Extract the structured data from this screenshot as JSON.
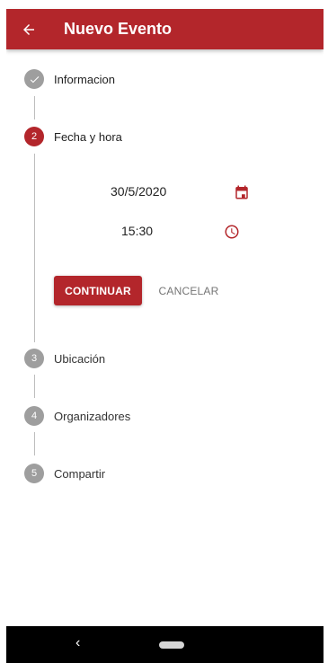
{
  "appbar": {
    "title": "Nuevo Evento",
    "back_icon": "arrow-left-icon"
  },
  "steps": [
    {
      "number": "",
      "label": "Informacion",
      "state": "done",
      "icon": "check-icon"
    },
    {
      "number": "2",
      "label": "Fecha y hora",
      "state": "active"
    },
    {
      "number": "3",
      "label": "Ubicación",
      "state": "pending"
    },
    {
      "number": "4",
      "label": "Organizadores",
      "state": "pending"
    },
    {
      "number": "5",
      "label": "Compartir",
      "state": "pending"
    }
  ],
  "form": {
    "date_value": "30/5/2020",
    "date_icon": "calendar-icon",
    "time_value": "15:30",
    "time_icon": "clock-icon"
  },
  "actions": {
    "continue_label": "CONTINUAR",
    "cancel_label": "CANCELAR"
  },
  "colors": {
    "accent": "#b3262b",
    "inactive_step": "#9e9e9e"
  },
  "navbar": {
    "back_icon": "nav-back-icon",
    "home_icon": "home-pill-icon"
  }
}
